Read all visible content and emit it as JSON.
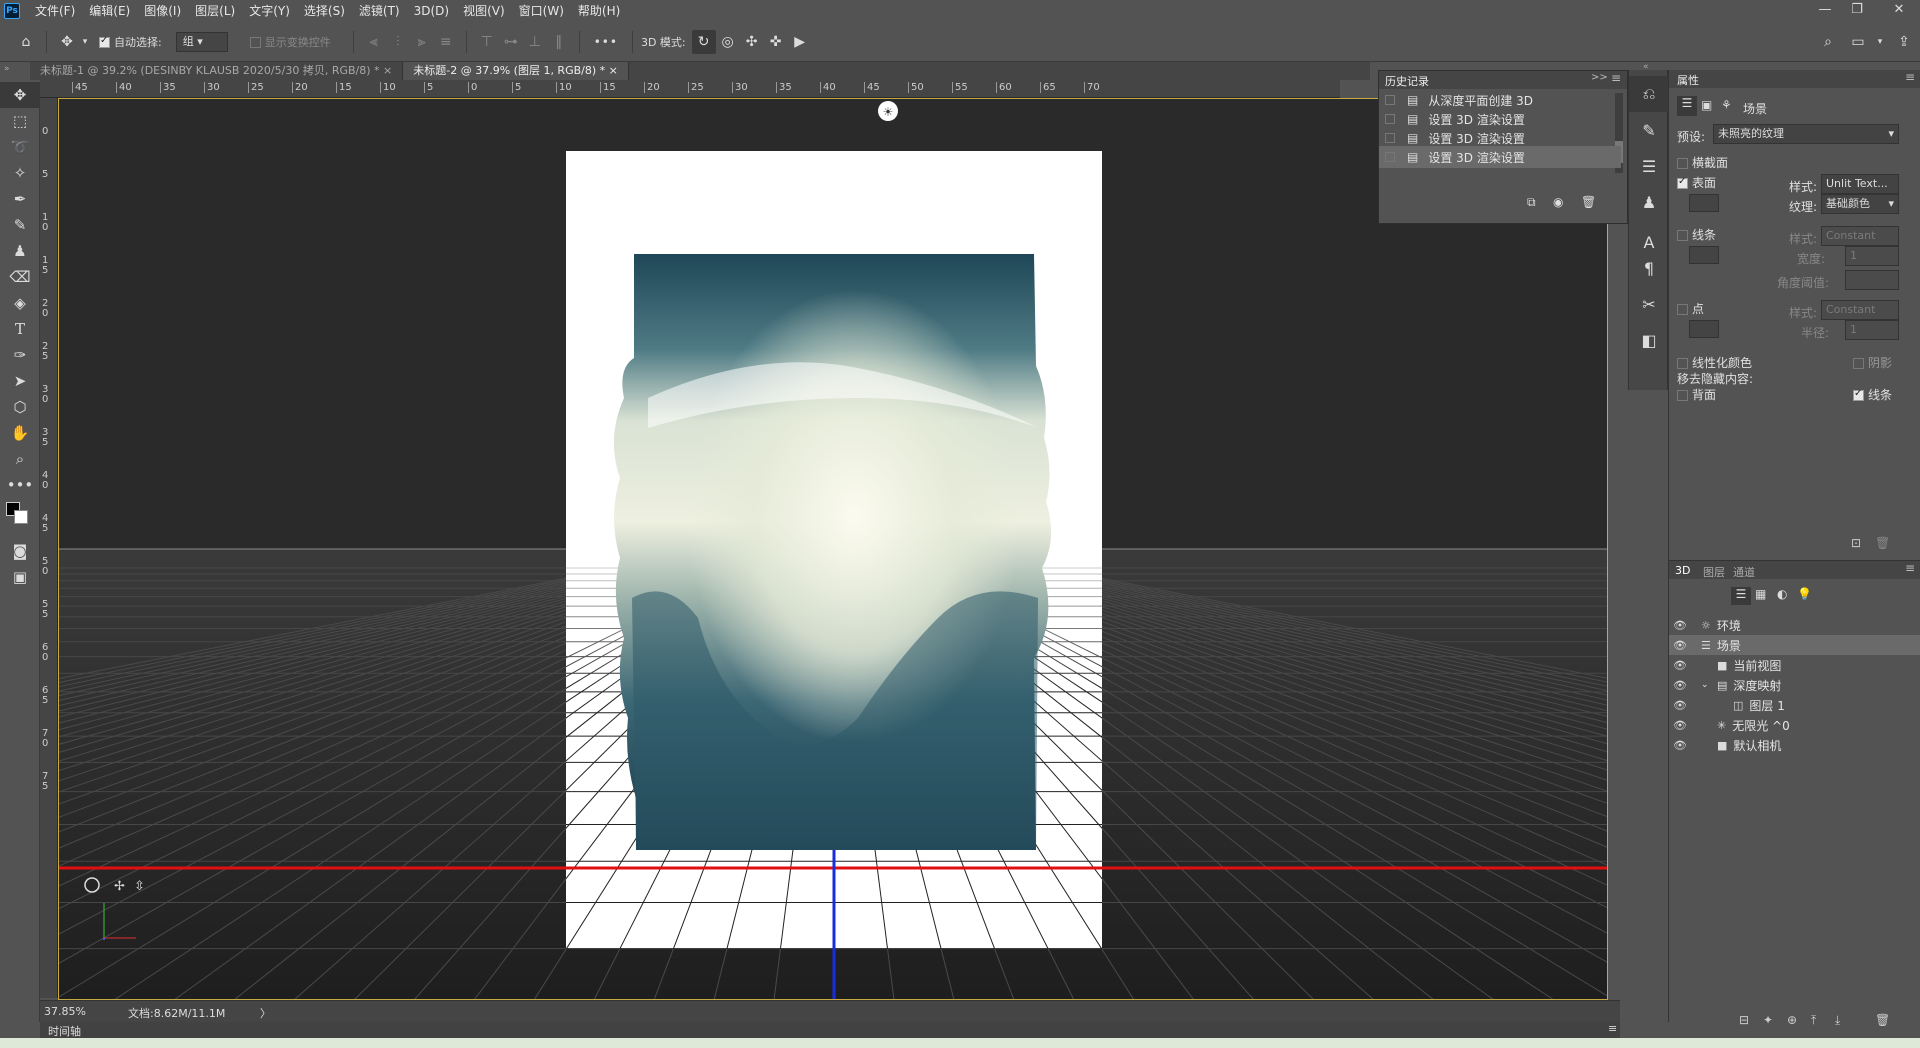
{
  "menubar": {
    "logo": "Ps",
    "items": [
      "文件(F)",
      "编辑(E)",
      "图像(I)",
      "图层(L)",
      "文字(Y)",
      "选择(S)",
      "滤镜(T)",
      "3D(D)",
      "视图(V)",
      "窗口(W)",
      "帮助(H)"
    ]
  },
  "window_controls": {
    "minimize": "—",
    "restore": "❐",
    "close": "✕"
  },
  "options": {
    "auto_select_label": "自动选择:",
    "auto_select_value": "组",
    "show_transform_label": "显示变换控件",
    "more_label": "•••",
    "mode3d_label": "3D 模式:"
  },
  "tabs": [
    {
      "label": "未标题-1 @ 39.2% (DESINBY KLAUSB    2020/5/30 拷贝, RGB/8) *",
      "close": "×"
    },
    {
      "label": "未标题-2 @ 37.9% (图层 1, RGB/8) *",
      "close": "×"
    }
  ],
  "ruler_h_labels": [
    "45",
    "40",
    "35",
    "30",
    "25",
    "20",
    "15",
    "10",
    "5",
    "0",
    "5",
    "10",
    "15",
    "20",
    "25",
    "30",
    "35",
    "40",
    "45",
    "50",
    "55",
    "60",
    "65",
    "70"
  ],
  "ruler_v_labels": [
    "5",
    "0",
    "5",
    "1 0",
    "1 5",
    "2 0",
    "2 5",
    "3 0",
    "3 5",
    "4 0",
    "4 5",
    "5 0",
    "5 5",
    "6 0",
    "6 5",
    "7 0",
    "7 5"
  ],
  "status": {
    "zoom": "37.85%",
    "doc": "文档:8.62M/11.1M",
    "arrow": "〉"
  },
  "timeline": {
    "label": "时间轴"
  },
  "history": {
    "title": "历史记录",
    "items": [
      {
        "label": "从深度平面创建 3D",
        "active": false
      },
      {
        "label": "设置 3D 渲染设置",
        "active": false
      },
      {
        "label": "设置 3D 渲染设置",
        "active": false
      },
      {
        "label": "设置 3D 渲染设置",
        "active": true
      }
    ]
  },
  "properties": {
    "title": "属性",
    "scene_label": "场景",
    "preset_label": "预设:",
    "preset_value": "未照亮的纹理",
    "cross_section": "横截面",
    "surface": "表面",
    "style_label": "样式:",
    "surface_style": "Unlit Text...",
    "texture_label": "纹理:",
    "texture_value": "基础颜色",
    "lines": "线条",
    "lines_style": "Constant",
    "width_label": "宽度:",
    "width_value": "1",
    "angle_label": "角度阈值:",
    "points": "点",
    "points_style": "Constant",
    "radius_label": "半径:",
    "radius_value": "1",
    "linearize": "线性化颜色",
    "shadow": "阴影",
    "remove_hidden": "移去隐藏内容:",
    "backface": "背面",
    "lines_check": "线条"
  },
  "panel3d": {
    "tabs": [
      "3D",
      "图层",
      "通道"
    ],
    "items": [
      {
        "label": "环境",
        "indent": 0,
        "icon": "☼",
        "selected": false
      },
      {
        "label": "场景",
        "indent": 0,
        "icon": "☰",
        "selected": true
      },
      {
        "label": "当前视图",
        "indent": 1,
        "icon": "■",
        "selected": false
      },
      {
        "label": "深度映射",
        "indent": 1,
        "icon": "▤",
        "selected": false
      },
      {
        "label": "图层 1",
        "indent": 2,
        "icon": "◫",
        "selected": false
      },
      {
        "label": "无限光 ^0",
        "indent": 1,
        "icon": "✳",
        "selected": false
      },
      {
        "label": "默认相机",
        "indent": 1,
        "icon": "■",
        "selected": false
      }
    ]
  },
  "colors": {
    "horizon_red": "#e01010",
    "axis_blue": "#1a2ce0",
    "canvas_border": "#c8a940",
    "sky_dark": "#234d5c",
    "cloud_light": "#e6ecd6"
  }
}
